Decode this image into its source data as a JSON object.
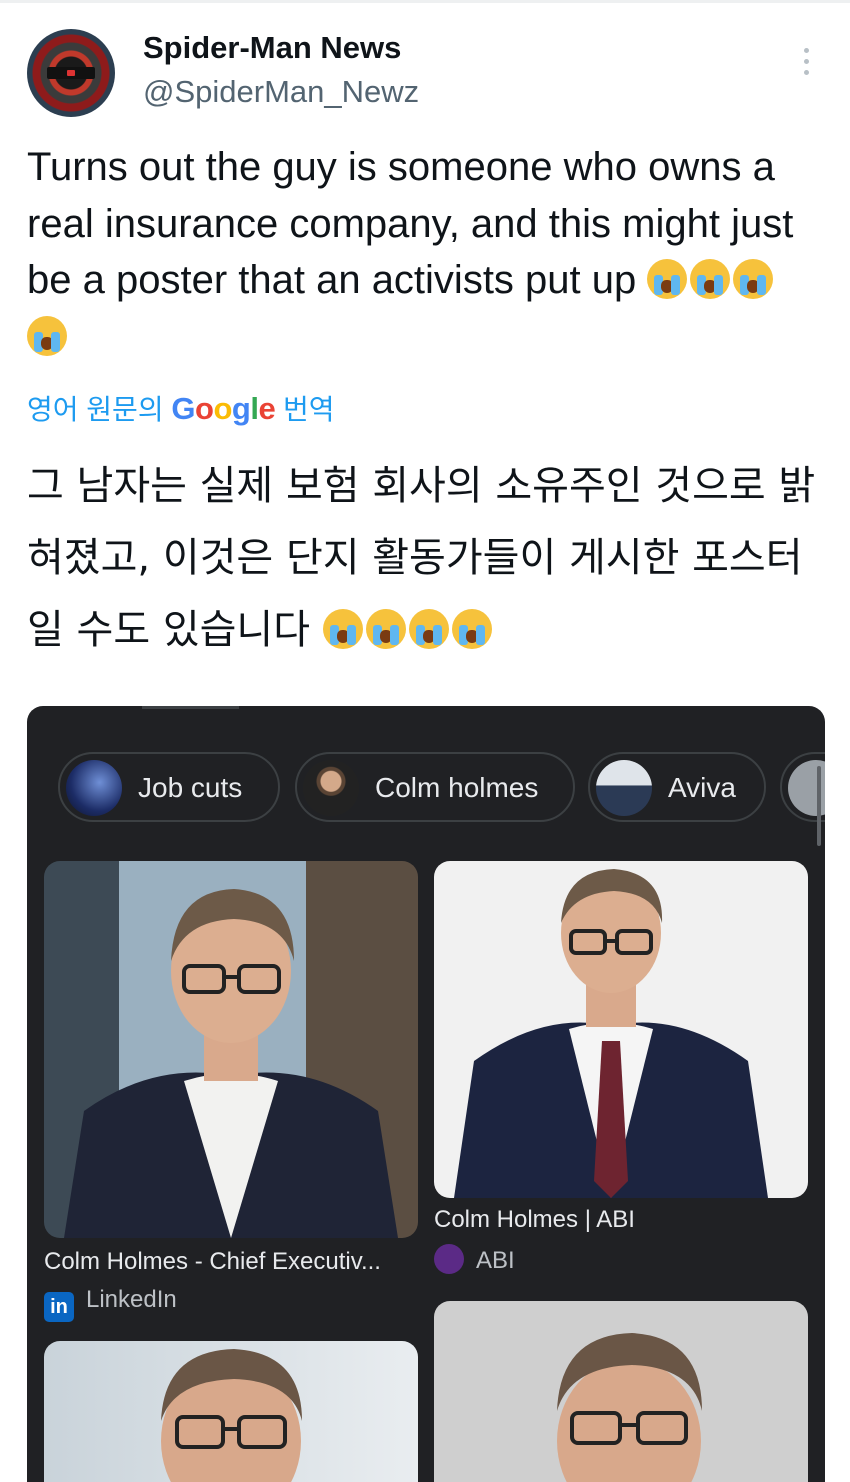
{
  "tweet": {
    "display_name": "Spider-Man News",
    "handle": "@SpiderMan_Newz",
    "text": "Turns out the guy is someone who owns a real insurance company, and this might just be a poster that an activists put up",
    "emoji": [
      "crying-face",
      "crying-face",
      "crying-face",
      "crying-face"
    ],
    "translate_prefix": "영어 원문의",
    "translate_brand": "Google",
    "translate_suffix": "번역",
    "translated_text": "그 남자는 실제 보험 회사의 소유주인 것으로 밝혀졌고, 이것은 단지 활동가들이 게시한 포스터일 수도 있습니다"
  },
  "search": {
    "chips": [
      {
        "label": "Job cuts",
        "icon": "thumbnail"
      },
      {
        "label": "Colm holmes",
        "icon": "thumbnail"
      },
      {
        "label": "Aviva",
        "icon": "thumbnail"
      }
    ],
    "results": [
      {
        "caption": "Colm Holmes - Chief Executiv...",
        "source": "LinkedIn",
        "source_icon": "linkedin-icon"
      },
      {
        "caption": "Colm Holmes | ABI",
        "source": "ABI",
        "source_icon": "abi-icon"
      }
    ]
  },
  "colors": {
    "link_blue": "#1d9bf0",
    "card_bg": "#202124",
    "linkedin": "#0a66c2"
  }
}
